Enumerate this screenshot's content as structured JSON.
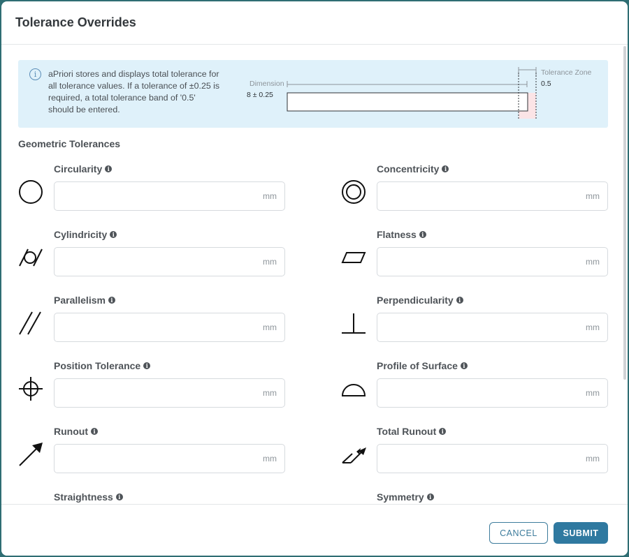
{
  "dialog": {
    "title": "Tolerance Overrides",
    "info_text": "aPriori stores and displays total tolerance for all tolerance values. If a tolerance of ±0.25 is required, a total tolerance band of '0.5' should be entered.",
    "diagram": {
      "dimension_label": "Dimension",
      "dimension_value": "8 ± 0.25",
      "zone_label": "Tolerance Zone",
      "zone_value": "0.5"
    },
    "section_title": "Geometric Tolerances",
    "fields": [
      {
        "label": "Circularity",
        "icon": "circularity-icon",
        "unit": "mm",
        "value": ""
      },
      {
        "label": "Concentricity",
        "icon": "concentricity-icon",
        "unit": "mm",
        "value": ""
      },
      {
        "label": "Cylindricity",
        "icon": "cylindricity-icon",
        "unit": "mm",
        "value": ""
      },
      {
        "label": "Flatness",
        "icon": "flatness-icon",
        "unit": "mm",
        "value": ""
      },
      {
        "label": "Parallelism",
        "icon": "parallelism-icon",
        "unit": "mm",
        "value": ""
      },
      {
        "label": "Perpendicularity",
        "icon": "perpendicularity-icon",
        "unit": "mm",
        "value": ""
      },
      {
        "label": "Position Tolerance",
        "icon": "position-icon",
        "unit": "mm",
        "value": ""
      },
      {
        "label": "Profile of Surface",
        "icon": "profile-of-surface-icon",
        "unit": "mm",
        "value": ""
      },
      {
        "label": "Runout",
        "icon": "runout-icon",
        "unit": "mm",
        "value": ""
      },
      {
        "label": "Total Runout",
        "icon": "total-runout-icon",
        "unit": "mm",
        "value": ""
      },
      {
        "label": "Straightness",
        "icon": "straightness-icon"
      },
      {
        "label": "Symmetry",
        "icon": "symmetry-icon"
      }
    ],
    "buttons": {
      "cancel": "CANCEL",
      "submit": "SUBMIT"
    }
  }
}
